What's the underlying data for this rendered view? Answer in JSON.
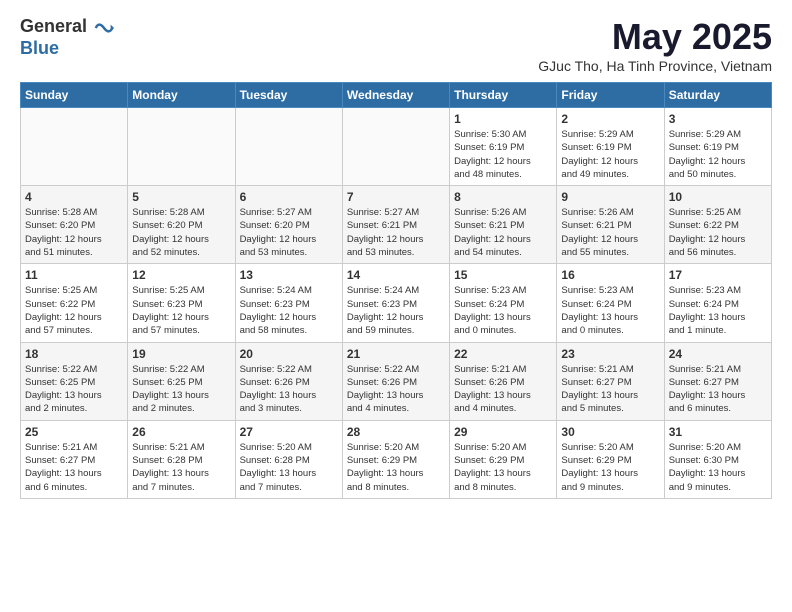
{
  "header": {
    "logo_general": "General",
    "logo_blue": "Blue",
    "month": "May 2025",
    "location": "GJuc Tho, Ha Tinh Province, Vietnam"
  },
  "weekdays": [
    "Sunday",
    "Monday",
    "Tuesday",
    "Wednesday",
    "Thursday",
    "Friday",
    "Saturday"
  ],
  "weeks": [
    [
      {
        "day": "",
        "info": ""
      },
      {
        "day": "",
        "info": ""
      },
      {
        "day": "",
        "info": ""
      },
      {
        "day": "",
        "info": ""
      },
      {
        "day": "1",
        "info": "Sunrise: 5:30 AM\nSunset: 6:19 PM\nDaylight: 12 hours\nand 48 minutes."
      },
      {
        "day": "2",
        "info": "Sunrise: 5:29 AM\nSunset: 6:19 PM\nDaylight: 12 hours\nand 49 minutes."
      },
      {
        "day": "3",
        "info": "Sunrise: 5:29 AM\nSunset: 6:19 PM\nDaylight: 12 hours\nand 50 minutes."
      }
    ],
    [
      {
        "day": "4",
        "info": "Sunrise: 5:28 AM\nSunset: 6:20 PM\nDaylight: 12 hours\nand 51 minutes."
      },
      {
        "day": "5",
        "info": "Sunrise: 5:28 AM\nSunset: 6:20 PM\nDaylight: 12 hours\nand 52 minutes."
      },
      {
        "day": "6",
        "info": "Sunrise: 5:27 AM\nSunset: 6:20 PM\nDaylight: 12 hours\nand 53 minutes."
      },
      {
        "day": "7",
        "info": "Sunrise: 5:27 AM\nSunset: 6:21 PM\nDaylight: 12 hours\nand 53 minutes."
      },
      {
        "day": "8",
        "info": "Sunrise: 5:26 AM\nSunset: 6:21 PM\nDaylight: 12 hours\nand 54 minutes."
      },
      {
        "day": "9",
        "info": "Sunrise: 5:26 AM\nSunset: 6:21 PM\nDaylight: 12 hours\nand 55 minutes."
      },
      {
        "day": "10",
        "info": "Sunrise: 5:25 AM\nSunset: 6:22 PM\nDaylight: 12 hours\nand 56 minutes."
      }
    ],
    [
      {
        "day": "11",
        "info": "Sunrise: 5:25 AM\nSunset: 6:22 PM\nDaylight: 12 hours\nand 57 minutes."
      },
      {
        "day": "12",
        "info": "Sunrise: 5:25 AM\nSunset: 6:23 PM\nDaylight: 12 hours\nand 57 minutes."
      },
      {
        "day": "13",
        "info": "Sunrise: 5:24 AM\nSunset: 6:23 PM\nDaylight: 12 hours\nand 58 minutes."
      },
      {
        "day": "14",
        "info": "Sunrise: 5:24 AM\nSunset: 6:23 PM\nDaylight: 12 hours\nand 59 minutes."
      },
      {
        "day": "15",
        "info": "Sunrise: 5:23 AM\nSunset: 6:24 PM\nDaylight: 13 hours\nand 0 minutes."
      },
      {
        "day": "16",
        "info": "Sunrise: 5:23 AM\nSunset: 6:24 PM\nDaylight: 13 hours\nand 0 minutes."
      },
      {
        "day": "17",
        "info": "Sunrise: 5:23 AM\nSunset: 6:24 PM\nDaylight: 13 hours\nand 1 minute."
      }
    ],
    [
      {
        "day": "18",
        "info": "Sunrise: 5:22 AM\nSunset: 6:25 PM\nDaylight: 13 hours\nand 2 minutes."
      },
      {
        "day": "19",
        "info": "Sunrise: 5:22 AM\nSunset: 6:25 PM\nDaylight: 13 hours\nand 2 minutes."
      },
      {
        "day": "20",
        "info": "Sunrise: 5:22 AM\nSunset: 6:26 PM\nDaylight: 13 hours\nand 3 minutes."
      },
      {
        "day": "21",
        "info": "Sunrise: 5:22 AM\nSunset: 6:26 PM\nDaylight: 13 hours\nand 4 minutes."
      },
      {
        "day": "22",
        "info": "Sunrise: 5:21 AM\nSunset: 6:26 PM\nDaylight: 13 hours\nand 4 minutes."
      },
      {
        "day": "23",
        "info": "Sunrise: 5:21 AM\nSunset: 6:27 PM\nDaylight: 13 hours\nand 5 minutes."
      },
      {
        "day": "24",
        "info": "Sunrise: 5:21 AM\nSunset: 6:27 PM\nDaylight: 13 hours\nand 6 minutes."
      }
    ],
    [
      {
        "day": "25",
        "info": "Sunrise: 5:21 AM\nSunset: 6:27 PM\nDaylight: 13 hours\nand 6 minutes."
      },
      {
        "day": "26",
        "info": "Sunrise: 5:21 AM\nSunset: 6:28 PM\nDaylight: 13 hours\nand 7 minutes."
      },
      {
        "day": "27",
        "info": "Sunrise: 5:20 AM\nSunset: 6:28 PM\nDaylight: 13 hours\nand 7 minutes."
      },
      {
        "day": "28",
        "info": "Sunrise: 5:20 AM\nSunset: 6:29 PM\nDaylight: 13 hours\nand 8 minutes."
      },
      {
        "day": "29",
        "info": "Sunrise: 5:20 AM\nSunset: 6:29 PM\nDaylight: 13 hours\nand 8 minutes."
      },
      {
        "day": "30",
        "info": "Sunrise: 5:20 AM\nSunset: 6:29 PM\nDaylight: 13 hours\nand 9 minutes."
      },
      {
        "day": "31",
        "info": "Sunrise: 5:20 AM\nSunset: 6:30 PM\nDaylight: 13 hours\nand 9 minutes."
      }
    ]
  ]
}
